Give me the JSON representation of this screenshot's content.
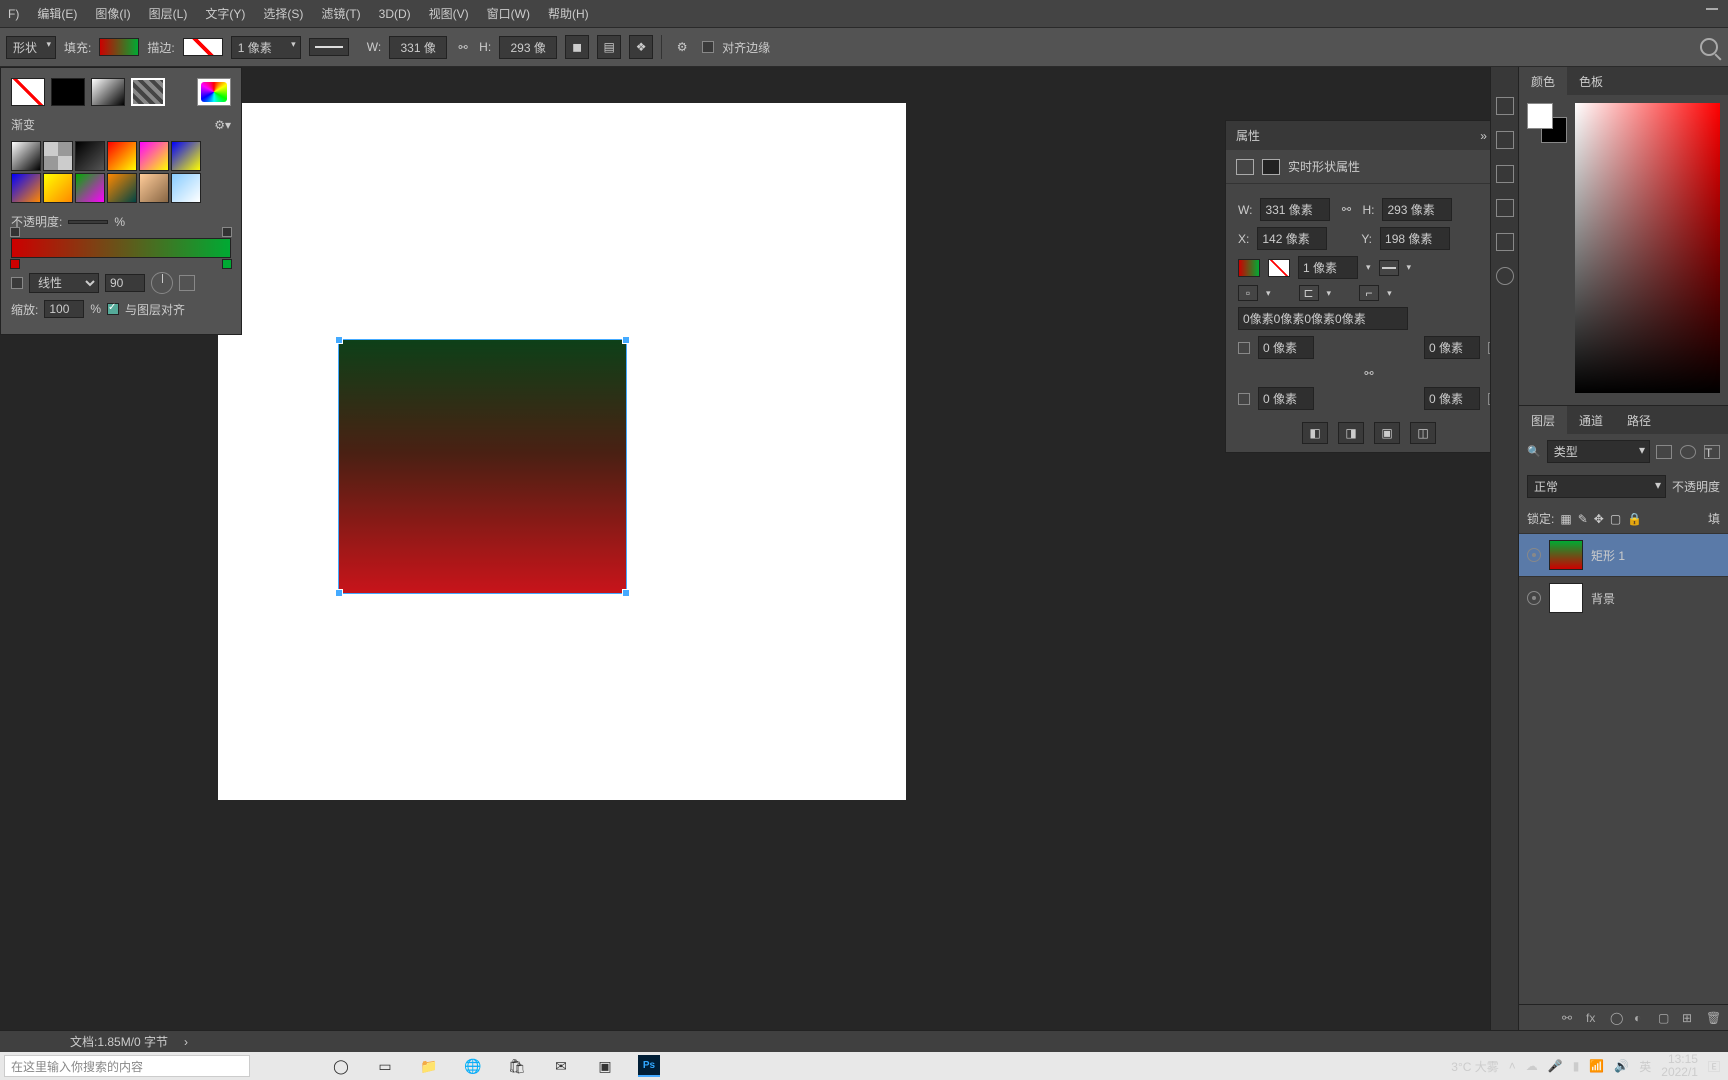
{
  "menu": {
    "file": "F)",
    "edit": "编辑(E)",
    "image": "图像(I)",
    "layer": "图层(L)",
    "text": "文字(Y)",
    "select": "选择(S)",
    "filter": "滤镜(T)",
    "threeD": "3D(D)",
    "view": "视图(V)",
    "window": "窗口(W)",
    "help": "帮助(H)"
  },
  "optbar": {
    "toolmode": "形状",
    "fill_lbl": "填充:",
    "stroke_lbl": "描边:",
    "stroke_w": "1 像素",
    "w_lbl": "W:",
    "w_val": "331 像",
    "h_lbl": "H:",
    "h_val": "293 像",
    "align_edges": "对齐边缘"
  },
  "fillpop": {
    "title": "渐变",
    "opacity_lbl": "不透明度:",
    "opacity_unit": "%",
    "style_chk": "线性",
    "angle": "90",
    "scale_lbl": "缩放:",
    "scale_val": "100",
    "scale_unit": "%",
    "align_lbl": "与图层对齐"
  },
  "properties": {
    "title": "属性",
    "subtitle": "实时形状属性",
    "w_lbl": "W:",
    "w_val": "331 像素",
    "h_lbl": "H:",
    "h_val": "293 像素",
    "x_lbl": "X:",
    "x_val": "142 像素",
    "y_lbl": "Y:",
    "y_val": "198 像素",
    "stroke_w": "1 像素",
    "corners": "0像素0像素0像素0像素",
    "c1": "0 像素",
    "c2": "0 像素",
    "c3": "0 像素",
    "c4": "0 像素"
  },
  "right": {
    "color_tab": "颜色",
    "swatch_tab": "色板",
    "layers_tab": "图层",
    "channels_tab": "通道",
    "paths_tab": "路径",
    "kind": "类型",
    "blend": "正常",
    "opacity_lbl": "不透明度",
    "lock_lbl": "锁定:",
    "fill_lbl": "填",
    "layer1": "矩形 1",
    "layer_bg": "背景"
  },
  "status": {
    "doc": "文档:1.85M/0 字节"
  },
  "taskbar": {
    "search_ph": "在这里输入你搜索的内容",
    "weather": "3°C 大雾",
    "time": "13:15",
    "date": "2022/1"
  }
}
